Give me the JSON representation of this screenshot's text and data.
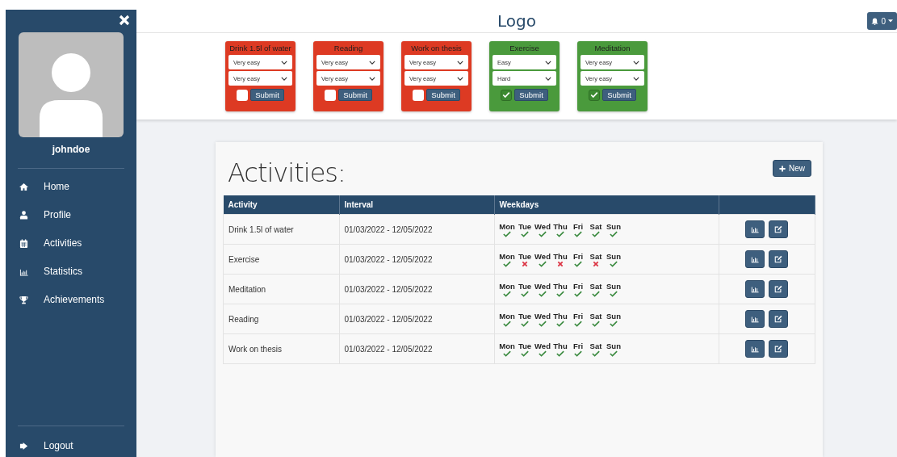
{
  "sidebar": {
    "username": "johndoe",
    "items": [
      {
        "label": "Home"
      },
      {
        "label": "Profile"
      },
      {
        "label": "Activities"
      },
      {
        "label": "Statistics"
      },
      {
        "label": "Achievements"
      }
    ],
    "logout": "Logout"
  },
  "header": {
    "logo": "Logo",
    "notifications": "0"
  },
  "habits": [
    {
      "title": "Drink 1.5l of water",
      "select_1": "Very easy",
      "select_2": "Very easy",
      "checked": false,
      "button": "Submit"
    },
    {
      "title": "Reading",
      "select_1": "Very easy",
      "select_2": "Very easy",
      "checked": false,
      "button": "Submit"
    },
    {
      "title": "Work on thesis",
      "select_1": "Very easy",
      "select_2": "Very easy",
      "checked": false,
      "button": "Submit"
    },
    {
      "title": "Exercise",
      "select_1": "Easy",
      "select_2": "Hard",
      "checked": true,
      "button": "Submit"
    },
    {
      "title": "Meditation",
      "select_1": "Very easy",
      "select_2": "Very easy",
      "checked": true,
      "button": "Submit"
    }
  ],
  "activities": {
    "title": "Activities:",
    "new_button": "New",
    "columns": [
      "Activity",
      "Interval",
      "Weekdays"
    ],
    "rows": [
      {
        "activity": "Drink 1.5l of water",
        "interval": "01/03/2022 - 12/05/2022",
        "days": [
          {
            "label": "Mon",
            "done": true
          },
          {
            "label": "Tue",
            "done": true
          },
          {
            "label": "Wed",
            "done": true
          },
          {
            "label": "Thu",
            "done": true
          },
          {
            "label": "Fri",
            "done": true
          },
          {
            "label": "Sat",
            "done": true
          },
          {
            "label": "Sun",
            "done": true
          }
        ]
      },
      {
        "activity": "Exercise",
        "interval": "01/03/2022 - 12/05/2022",
        "days": [
          {
            "label": "Mon",
            "done": true
          },
          {
            "label": "Tue",
            "done": false
          },
          {
            "label": "Wed",
            "done": true
          },
          {
            "label": "Thu",
            "done": false
          },
          {
            "label": "Fri",
            "done": true
          },
          {
            "label": "Sat",
            "done": false
          },
          {
            "label": "Sun",
            "done": true
          }
        ]
      },
      {
        "activity": "Meditation",
        "interval": "01/03/2022 - 12/05/2022",
        "days": [
          {
            "label": "Mon",
            "done": true
          },
          {
            "label": "Tue",
            "done": true
          },
          {
            "label": "Wed",
            "done": true
          },
          {
            "label": "Thu",
            "done": true
          },
          {
            "label": "Fri",
            "done": true
          },
          {
            "label": "Sat",
            "done": true
          },
          {
            "label": "Sun",
            "done": true
          }
        ]
      },
      {
        "activity": "Reading",
        "interval": "01/03/2022 - 12/05/2022",
        "days": [
          {
            "label": "Mon",
            "done": true
          },
          {
            "label": "Tue",
            "done": true
          },
          {
            "label": "Wed",
            "done": true
          },
          {
            "label": "Thu",
            "done": true
          },
          {
            "label": "Fri",
            "done": true
          },
          {
            "label": "Sat",
            "done": true
          },
          {
            "label": "Sun",
            "done": true
          }
        ]
      },
      {
        "activity": "Work on thesis",
        "interval": "01/03/2022 - 12/05/2022",
        "days": [
          {
            "label": "Mon",
            "done": true
          },
          {
            "label": "Tue",
            "done": true
          },
          {
            "label": "Wed",
            "done": true
          },
          {
            "label": "Thu",
            "done": true
          },
          {
            "label": "Fri",
            "done": true
          },
          {
            "label": "Sat",
            "done": true
          },
          {
            "label": "Sun",
            "done": true
          }
        ]
      }
    ]
  }
}
